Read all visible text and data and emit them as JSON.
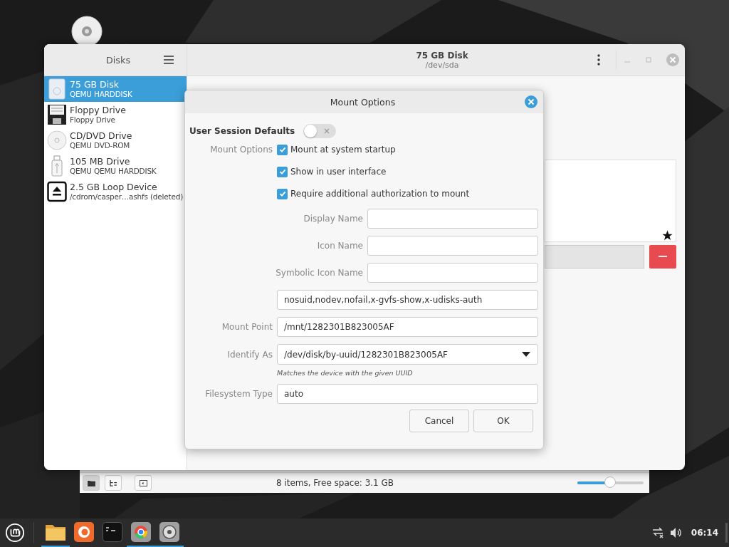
{
  "files_window": {
    "view_buttons": [
      {
        "kind": "icons",
        "selected": true
      },
      {
        "kind": "tree",
        "selected": false
      },
      {
        "kind": "sidebar",
        "selected": false
      }
    ],
    "status": "8 items, Free space: 3.1 GB",
    "zoom_slider": {
      "level": 0.5
    }
  },
  "disks_window": {
    "sidebar_title": "Disks",
    "devices": [
      {
        "kind": "disk",
        "name": "75 GB Disk",
        "detail": "QEMU HARDDISK",
        "selected": true
      },
      {
        "kind": "floppy",
        "name": "Floppy Drive",
        "detail": "Floppy Drive",
        "selected": false
      },
      {
        "kind": "optical",
        "name": "CD/DVD Drive",
        "detail": "QEMU DVD-ROM",
        "selected": false
      },
      {
        "kind": "usb",
        "name": "105 MB Drive",
        "detail": "QEMU QEMU HARDDISK",
        "selected": false
      },
      {
        "kind": "loop",
        "name": "2.5 GB Loop Device",
        "detail": "/cdrom/casper…ashfs (deleted)",
        "selected": false
      }
    ],
    "title": "75 GB Disk",
    "subtitle": "/dev/sda"
  },
  "dialog": {
    "title": "Mount Options",
    "session_defaults": {
      "label": "User Session Defaults",
      "on": false
    },
    "options_label": "Mount Options",
    "checkboxes": [
      {
        "label": "Mount at system startup",
        "checked": true
      },
      {
        "label": "Show in user interface",
        "checked": true
      },
      {
        "label": "Require additional authorization to mount",
        "checked": true
      }
    ],
    "fields": [
      {
        "kind": "short_entry",
        "label": "Display Name"
      },
      {
        "kind": "short_entry",
        "label": "Icon Name"
      },
      {
        "kind": "short_entry",
        "label": "Symbolic Icon Name"
      },
      {
        "kind": "entry",
        "value": "nosuid,nodev,nofail,x-gvfs-show,x-udisks-auth"
      },
      {
        "kind": "entry",
        "label": "Mount Point",
        "value": "/mnt/1282301B823005AF"
      },
      {
        "kind": "combo",
        "label": "Identify As",
        "value": "/dev/disk/by-uuid/1282301B823005AF",
        "hint": "Matches the device with the given UUID"
      },
      {
        "kind": "entry",
        "label": "Filesystem Type",
        "value": "auto"
      }
    ],
    "buttons": [
      "Cancel",
      "OK"
    ]
  },
  "taskbar": {
    "apps": [
      {
        "kind": "folder",
        "running": true
      },
      {
        "kind": "firefox",
        "running": false
      },
      {
        "kind": "terminal",
        "running": false
      },
      {
        "kind": "chrome",
        "running": true
      },
      {
        "kind": "disks",
        "running": true
      }
    ],
    "clock": "06:14"
  }
}
